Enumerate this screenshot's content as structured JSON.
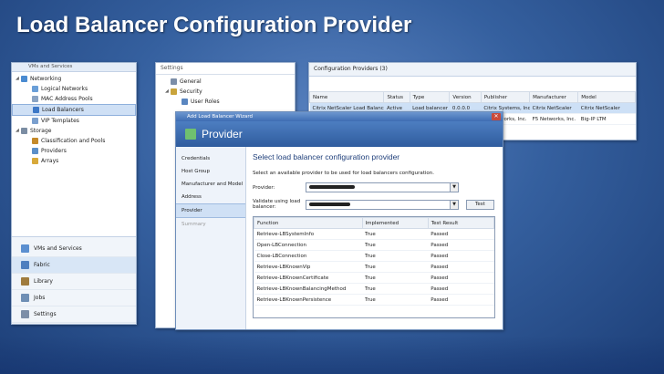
{
  "slide_title": "Load Balancer Configuration Provider",
  "left_nav": {
    "top_label": "VMs and Services",
    "tree": [
      {
        "label": "Networking",
        "icon": "network-icon",
        "indent": 0,
        "expander": "◢"
      },
      {
        "label": "Logical Networks",
        "icon": "logical-network-icon",
        "indent": 1
      },
      {
        "label": "MAC Address Pools",
        "icon": "mac-pool-icon",
        "indent": 1
      },
      {
        "label": "Load Balancers",
        "icon": "load-balancer-icon",
        "indent": 1,
        "selected": true
      },
      {
        "label": "VIP Templates",
        "icon": "vip-template-icon",
        "indent": 1
      },
      {
        "label": "Storage",
        "icon": "storage-icon",
        "indent": 0,
        "expander": "◢"
      },
      {
        "label": "Classification and Pools",
        "icon": "classification-icon",
        "indent": 1
      },
      {
        "label": "Providers",
        "icon": "providers-icon",
        "indent": 1
      },
      {
        "label": "Arrays",
        "icon": "arrays-icon",
        "indent": 1
      }
    ],
    "buttons": [
      {
        "label": "VMs and Services",
        "icon": "vms-services-icon"
      },
      {
        "label": "Fabric",
        "icon": "fabric-icon",
        "active": true
      },
      {
        "label": "Library",
        "icon": "library-icon"
      },
      {
        "label": "Jobs",
        "icon": "jobs-icon"
      },
      {
        "label": "Settings",
        "icon": "settings-icon"
      }
    ]
  },
  "settings_panel": {
    "header": "Settings",
    "items": [
      {
        "label": "General",
        "icon": "general-icon"
      },
      {
        "label": "Security",
        "icon": "security-icon",
        "expander": "◢"
      },
      {
        "label": "User Roles",
        "icon": "user-roles-icon"
      }
    ]
  },
  "providers_panel": {
    "header": "Configuration Providers (3)",
    "columns": [
      "Name",
      "Status",
      "Type",
      "Version",
      "Publisher",
      "Manufacturer",
      "Model"
    ],
    "rows": [
      [
        "Citrix NetScaler Load Balancer",
        "Active",
        "Load balancer",
        "0.0.0.0",
        "Citrix Systems, Inc.",
        "Citrix NetScaler",
        "Citrix NetScaler"
      ],
      [
        "",
        "",
        "",
        "",
        "",
        "F5 Networks, Inc.",
        "Big-IP LTM"
      ]
    ],
    "row2_publisher_fragment": "works, Inc."
  },
  "wizard": {
    "title": "Add Load Balancer Wizard",
    "close_glyph": "✕",
    "header_title": "Provider",
    "steps": [
      {
        "label": "Credentials"
      },
      {
        "label": "Host Group"
      },
      {
        "label": "Manufacturer and Model"
      },
      {
        "label": "Address"
      },
      {
        "label": "Provider",
        "active": true
      },
      {
        "label": "Summary",
        "disabled": true
      }
    ],
    "heading": "Select load balancer configuration provider",
    "description": "Select an available provider to be used for load balancers configuration.",
    "provider_label": "Provider:",
    "validate_label": "Validate using load balancer:",
    "test_button": "Test",
    "table_columns": [
      "Function",
      "Implemented",
      "Test Result"
    ],
    "table_rows": [
      [
        "Retrieve-LBSystemInfo",
        "True",
        "Passed"
      ],
      [
        "Open-LBConnection",
        "True",
        "Passed"
      ],
      [
        "Close-LBConnection",
        "True",
        "Passed"
      ],
      [
        "Retrieve-LBKnownVip",
        "True",
        "Passed"
      ],
      [
        "Retrieve-LBKnownCertificate",
        "True",
        "Passed"
      ],
      [
        "Retrieve-LBKnownBalancingMethod",
        "True",
        "Passed"
      ],
      [
        "Retrieve-LBKnownPersistence",
        "True",
        "Passed"
      ]
    ]
  },
  "colors": {
    "network-icon": "#4a8bd1",
    "logical-network-icon": "#6a9fd8",
    "mac-pool-icon": "#8aa4c4",
    "load-balancer-icon": "#3d78c7",
    "vip-template-icon": "#7a9fce",
    "storage-icon": "#7b8da3",
    "classification-icon": "#c58a2a",
    "providers-icon": "#5b8fc9",
    "arrays-icon": "#d8a93a",
    "vms-services-icon": "#5b8fd0",
    "fabric-icon": "#4f7fbf",
    "library-icon": "#a07c3e",
    "jobs-icon": "#6f8fb5",
    "settings-icon": "#7c8ea8",
    "general-icon": "#7c8ea8",
    "security-icon": "#c9a43c",
    "user-roles-icon": "#5a86c0"
  }
}
